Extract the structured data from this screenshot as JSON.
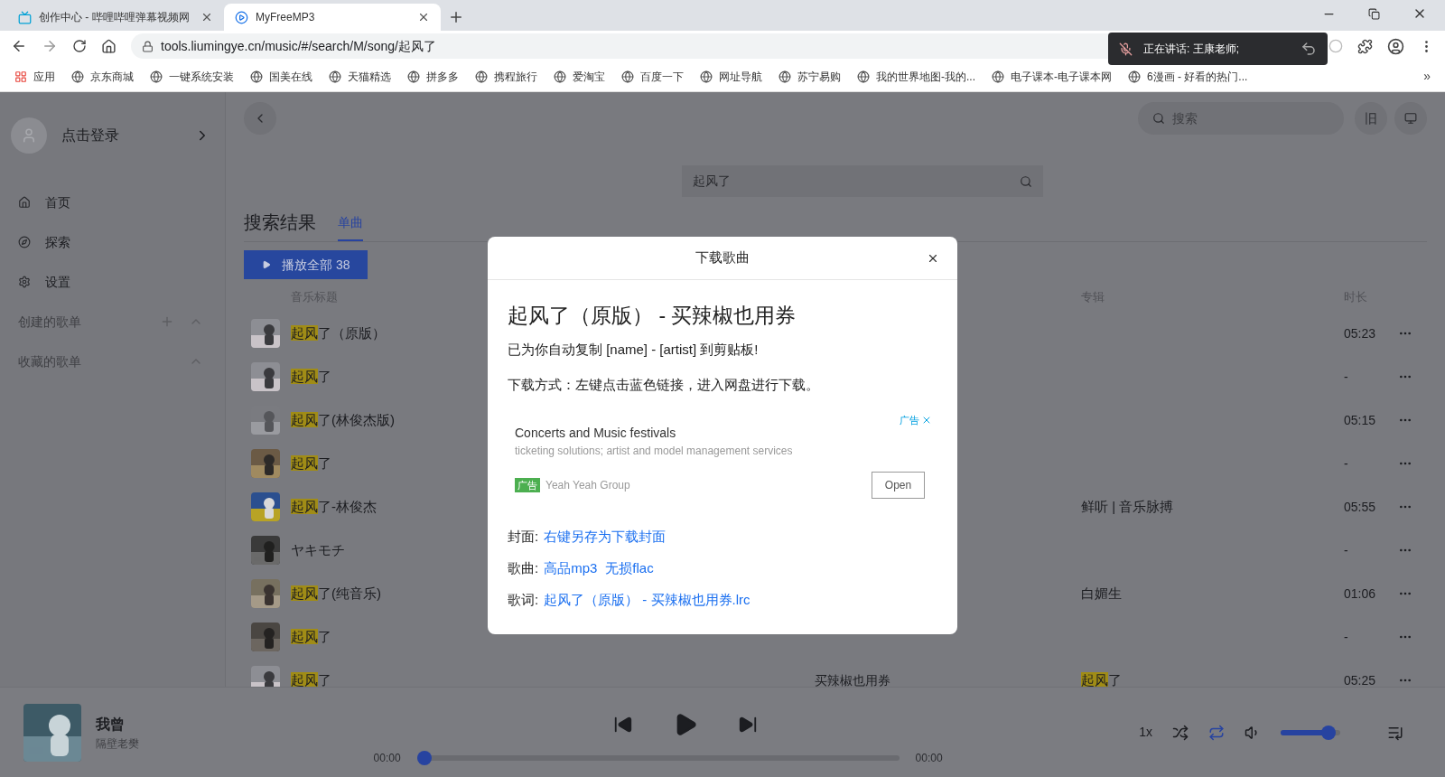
{
  "browser": {
    "tabs": [
      {
        "title": "创作中心 - 哔哩哔哩弹幕视频网",
        "selected": false
      },
      {
        "title": "MyFreeMP3",
        "selected": true
      }
    ],
    "address": "tools.liumingye.cn/music/#/search/M/song/起风了",
    "speaking_popup": "正在讲话: 王康老师;",
    "bookmarks": [
      "应用",
      "京东商城",
      "一键系统安装",
      "国美在线",
      "天猫精选",
      "拼多多",
      "携程旅行",
      "爱淘宝",
      "百度一下",
      "网址导航",
      "苏宁易购",
      "我的世界地图-我的...",
      "电子课本-电子课本网",
      "6漫画 - 好看的热门..."
    ],
    "more_bookmarks": "»"
  },
  "sidebar": {
    "login": "点击登录",
    "nav": [
      {
        "kind": "home",
        "label": "首页"
      },
      {
        "kind": "explore",
        "label": "探索"
      },
      {
        "kind": "settings",
        "label": "设置"
      }
    ],
    "sections": [
      {
        "label": "创建的歌单",
        "addable": true
      },
      {
        "label": "收藏的歌单",
        "addable": false
      }
    ]
  },
  "topbar": {
    "search_placeholder": "搜索",
    "old_label": "旧"
  },
  "search": {
    "value": "起风了"
  },
  "results": {
    "title": "搜索结果",
    "tabs": [
      {
        "label": "单曲",
        "selected": true
      }
    ],
    "play_all": "播放全部 38",
    "headers": {
      "title": "音乐标题",
      "album": "专辑",
      "duration": "时长"
    },
    "rows": [
      {
        "title": {
          "match": "起风",
          "rest": "了（原版）"
        },
        "duration": "05:23"
      },
      {
        "title": {
          "match": "起风",
          "rest": "了"
        },
        "duration": "-"
      },
      {
        "title": {
          "match": "起风",
          "rest": "了(林俊杰版)"
        },
        "duration": "05:15"
      },
      {
        "title": {
          "match": "起风",
          "rest": "了"
        },
        "duration": "-"
      },
      {
        "title": {
          "match": "起风",
          "rest": "了-林俊杰"
        },
        "album": {
          "rest": "鲜听 | 音乐脉搏"
        },
        "duration": "05:55"
      },
      {
        "title": {
          "rest": "ヤキモチ"
        },
        "duration": "-"
      },
      {
        "title": {
          "match": "起风",
          "rest": "了(纯音乐)"
        },
        "album": {
          "rest": "白媚生"
        },
        "duration": "01:06"
      },
      {
        "title": {
          "match": "起风",
          "rest": "了"
        },
        "duration": "-"
      },
      {
        "title": {
          "match": "起风",
          "rest": "了"
        },
        "artist": "买辣椒也用券",
        "album": {
          "match": "起风",
          "rest": "了"
        },
        "duration": "05:25"
      }
    ]
  },
  "player": {
    "title": "我曾",
    "artist": "隔壁老樊",
    "speed": "1x",
    "elapsed": "00:00",
    "total": "00:00",
    "progress": {
      "level": 0
    },
    "volume": {
      "level": 0.9
    }
  },
  "dialog": {
    "title": "下载歌曲",
    "heading": "起风了（原版） - 买辣椒也用券",
    "copied_note": "已为你自动复制 [name] - [artist] 到剪贴板!",
    "instructions": "下载方式：左键点击蓝色链接，进入网盘进行下载。",
    "ad": {
      "corner_label": "广告",
      "title": "Concerts and Music festivals",
      "description": "ticketing solutions; artist and model management services",
      "badge": "广告",
      "advertiser": "Yeah Yeah Group",
      "button": "Open"
    },
    "links": [
      {
        "label": "封面:",
        "items": [
          "右键另存为下载封面"
        ]
      },
      {
        "label": "歌曲:",
        "items": [
          "高品mp3",
          "无损flac"
        ]
      },
      {
        "label": "歌词:",
        "items": [
          "起风了（原版） - 买辣椒也用券.lrc"
        ]
      }
    ]
  }
}
